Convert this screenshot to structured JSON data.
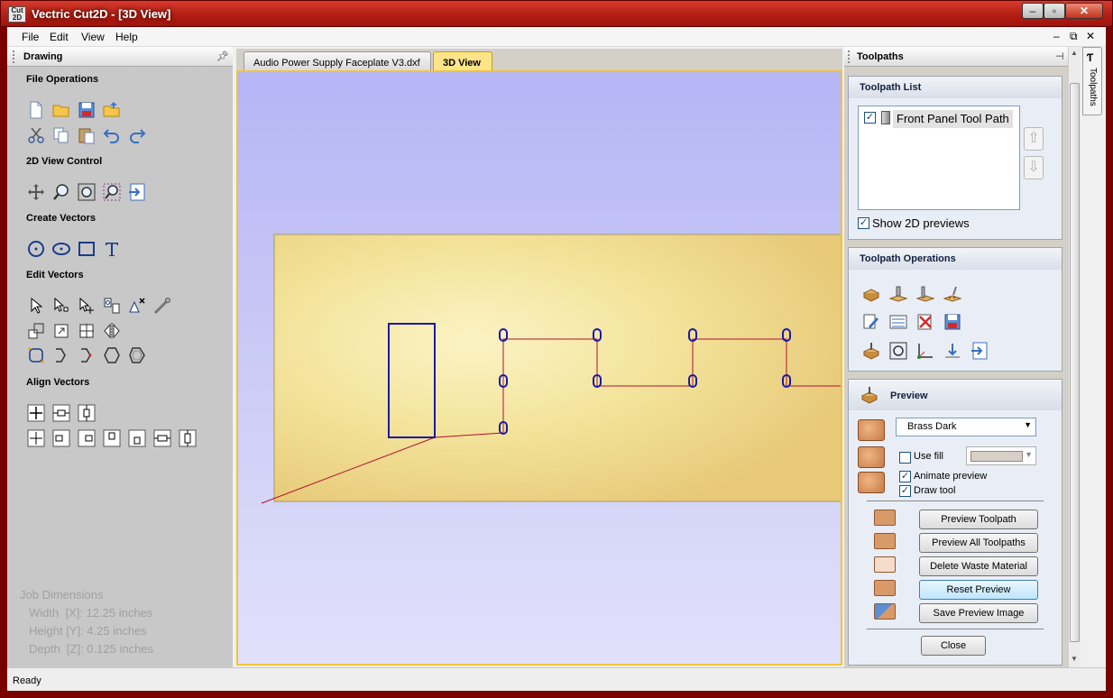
{
  "window": {
    "title": "Vectric Cut2D - [3D View]",
    "app_icon_text": "Cut 2D"
  },
  "menu": {
    "items": [
      "File",
      "Edit",
      "View",
      "Help"
    ]
  },
  "left_panel": {
    "title": "Drawing",
    "sections": {
      "file_ops": "File Operations",
      "view_control": "2D View Control",
      "create_vectors": "Create Vectors",
      "edit_vectors": "Edit Vectors",
      "align_vectors": "Align Vectors"
    },
    "job_dimensions": {
      "title": "Job Dimensions",
      "width": "Width  [X]: 12.25 inches",
      "height": "Height [Y]: 4.25 inches",
      "depth": "Depth  [Z]: 0.125 inches"
    }
  },
  "tabs": [
    {
      "label": "Audio Power Supply Faceplate V3.dxf",
      "active": false
    },
    {
      "label": "3D View",
      "active": true
    }
  ],
  "right_panel": {
    "title": "Toolpaths",
    "side_tab": "Toolpaths",
    "toolpath_list": {
      "title": "Toolpath List",
      "items": [
        {
          "name": "Front Panel Tool Path",
          "checked": true
        }
      ],
      "show_2d_previews": "Show 2D previews",
      "show_2d_previews_checked": true
    },
    "toolpath_operations": {
      "title": "Toolpath Operations"
    },
    "preview": {
      "title": "Preview",
      "material": "Brass Dark",
      "use_fill": "Use fill",
      "use_fill_checked": false,
      "animate_preview": "Animate preview",
      "animate_preview_checked": true,
      "draw_tool": "Draw tool",
      "draw_tool_checked": true,
      "buttons": {
        "preview_toolpath": "Preview Toolpath",
        "preview_all": "Preview All Toolpaths",
        "delete_waste": "Delete Waste Material",
        "reset": "Reset Preview",
        "save_image": "Save Preview Image",
        "close": "Close"
      }
    }
  },
  "status": {
    "text": "Ready"
  },
  "colors": {
    "accent_tab": "#ffe48a",
    "viewport_bg": "#c9c9f6",
    "material": "#f3e39a",
    "vector_blue": "#1a1aa8",
    "toolpath_red": "#b01030"
  }
}
